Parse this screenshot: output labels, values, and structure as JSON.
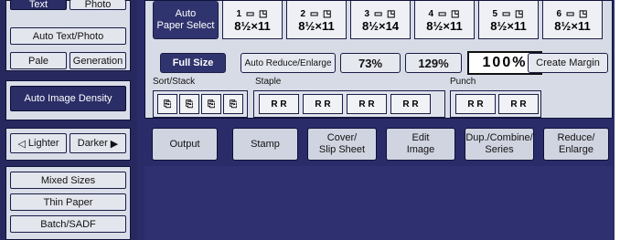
{
  "sidebar": {
    "top_buttons": [
      "Text",
      "Photo"
    ],
    "auto_text_photo": "Auto Text/Photo",
    "pale": "Pale",
    "generation": "Generation",
    "auto_image_density": "Auto Image Density",
    "lighter": "Lighter",
    "darker": "Darker",
    "lighter_icon": "◁",
    "darker_icon": "▶",
    "bottom_items": [
      "Mixed Sizes",
      "Thin Paper",
      "Batch/SADF"
    ]
  },
  "paper": {
    "auto_select": "Auto\nPaper Select",
    "trays": [
      {
        "num": "1",
        "size": "8½×11"
      },
      {
        "num": "2",
        "size": "8½×11"
      },
      {
        "num": "3",
        "size": "8½×14"
      },
      {
        "num": "4",
        "size": "8½×11"
      },
      {
        "num": "5",
        "size": "8½×11"
      },
      {
        "num": "6",
        "size": "8½×11"
      }
    ]
  },
  "ratio": {
    "full_size": "Full Size",
    "auto_reduce": "Auto Reduce/Enlarge",
    "preset_73": "73%",
    "preset_129": "129%",
    "current": "100%",
    "create_margin": "Create Margin"
  },
  "finishing": {
    "sort_label": "Sort/Stack",
    "staple_label": "Staple",
    "punch_label": "Punch"
  },
  "tabs": [
    {
      "label": "Output"
    },
    {
      "label": "Stamp"
    },
    {
      "label": "Cover/\nSlip Sheet"
    },
    {
      "label": "Edit\nImage"
    },
    {
      "label": "Dup./Combine/\nSeries"
    },
    {
      "label": "Reduce/\nEnlarge"
    }
  ]
}
